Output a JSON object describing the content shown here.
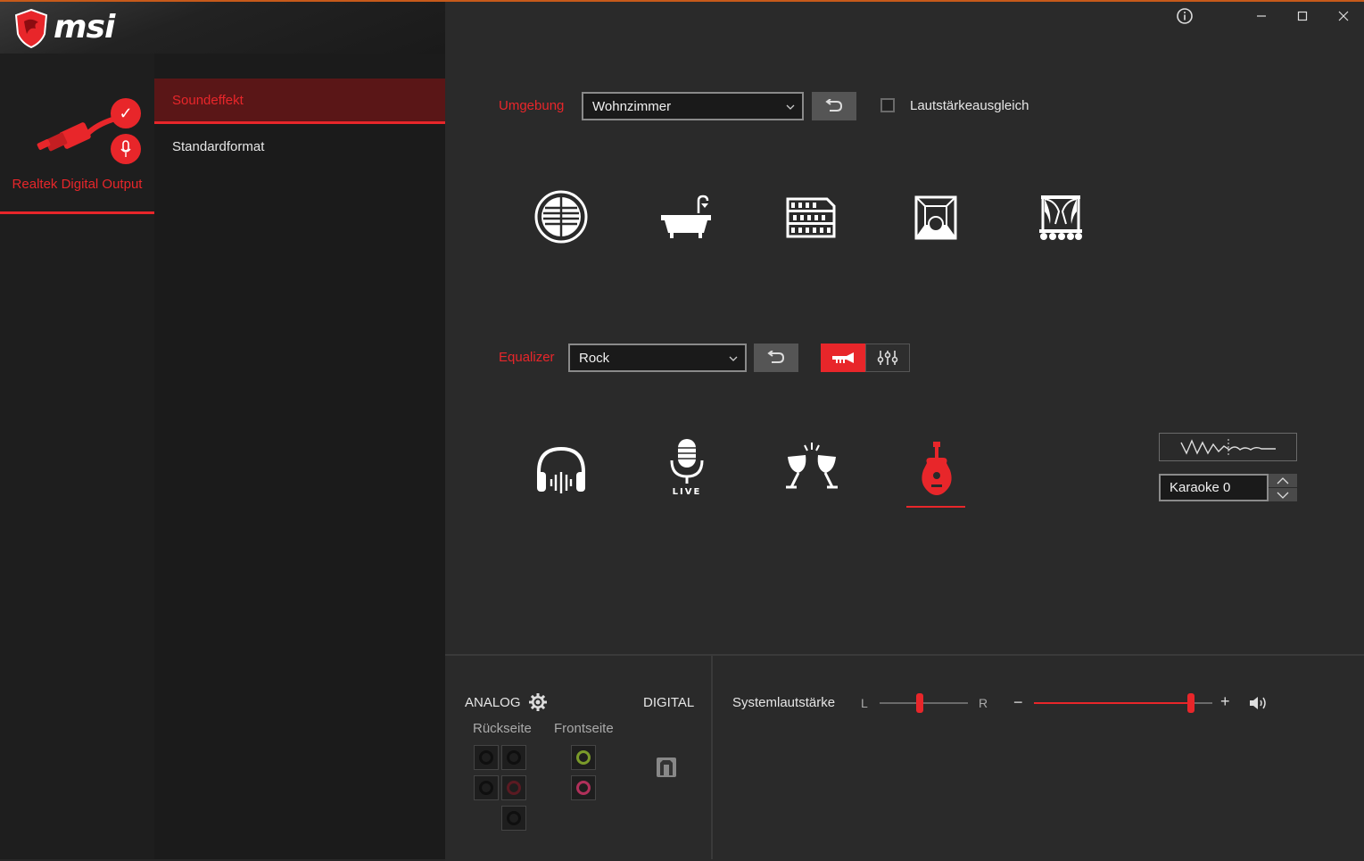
{
  "app": {
    "brand": "msi"
  },
  "window_controls": {
    "info": "ⓘ",
    "minimize": "—",
    "maximize": "☐",
    "close": "✕"
  },
  "device": {
    "label": "Realtek Digital Output"
  },
  "menu": {
    "items": [
      {
        "label": "Soundeffekt",
        "active": true
      },
      {
        "label": "Standardformat",
        "active": false
      }
    ]
  },
  "environment": {
    "label": "Umgebung",
    "selected": "Wohnzimmer",
    "loudness_label": "Lautstärkeausgleich",
    "loudness_checked": false,
    "presets": [
      "round-speaker-icon",
      "bathtub-icon",
      "colosseum-icon",
      "room-icon",
      "stage-icon"
    ]
  },
  "equalizer": {
    "label": "Equalizer",
    "selected": "Rock",
    "presets": [
      "headphones-icon",
      "live-microphone-icon",
      "party-toast-icon",
      "guitar-icon"
    ],
    "active_preset": "guitar-icon",
    "live_text": "LIVE"
  },
  "karaoke": {
    "value": "Karaoke 0"
  },
  "bottom": {
    "analog_label": "ANALOG",
    "digital_label": "DIGITAL",
    "rear_label": "Rückseite",
    "front_label": "Frontseite",
    "system_volume_label": "Systemlautstärke",
    "left_label": "L",
    "right_label": "R",
    "minus": "−",
    "plus": "+",
    "balance": 0.45,
    "volume": 0.88
  },
  "colors": {
    "accent": "#e8262a",
    "background": "#2a2a2a"
  }
}
